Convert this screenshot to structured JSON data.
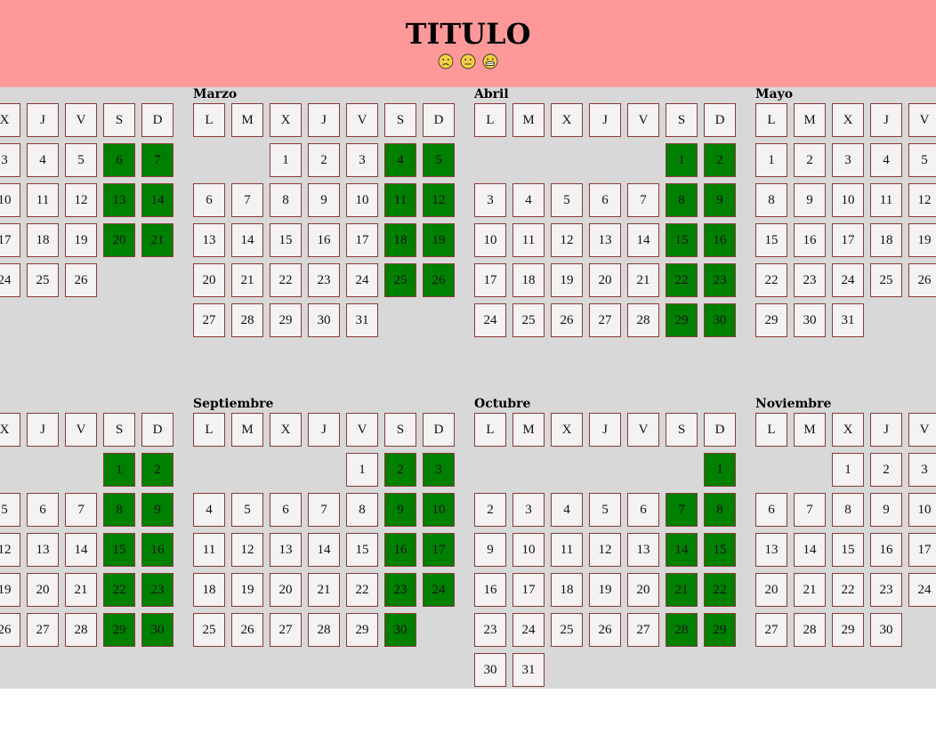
{
  "header": {
    "title": "TITULO",
    "faces": [
      "sad-face-icon",
      "neutral-face-icon",
      "grinning-face-icon"
    ],
    "background": "#ff9999"
  },
  "colors": {
    "weekend": "#008000",
    "cell": "#f4f2f2",
    "border": "#8b3a3a",
    "panel": "#d8d8d8"
  },
  "weekday_headers": [
    "L",
    "M",
    "X",
    "J",
    "V",
    "S",
    "D"
  ],
  "rows": [
    {
      "months": [
        {
          "name": "",
          "visible_cols_from": 2,
          "first_weekday": 1,
          "days": 26
        },
        {
          "name": "Marzo",
          "first_weekday": 3,
          "days": 31
        },
        {
          "name": "Abril",
          "first_weekday": 6,
          "days": 30
        },
        {
          "name": "Mayo",
          "first_weekday": 1,
          "days": 31,
          "visible_cols_to": 4
        }
      ]
    },
    {
      "months": [
        {
          "name": "",
          "visible_cols_from": 2,
          "first_weekday": 6,
          "days": 31
        },
        {
          "name": "Septiembre",
          "first_weekday": 5,
          "days": 30
        },
        {
          "name": "Octubre",
          "first_weekday": 7,
          "days": 31
        },
        {
          "name": "Noviembre",
          "first_weekday": 3,
          "days": 30,
          "visible_cols_to": 4
        }
      ]
    }
  ]
}
